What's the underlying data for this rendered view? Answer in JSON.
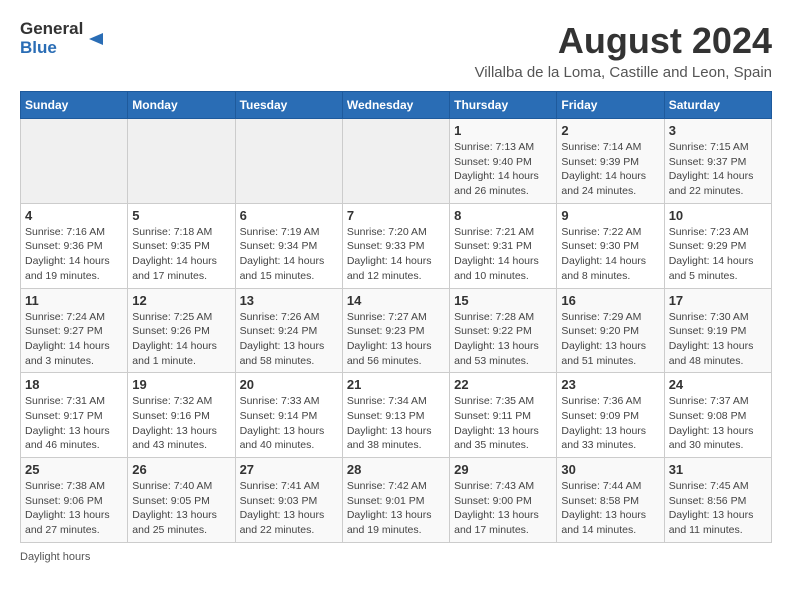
{
  "header": {
    "logo_general": "General",
    "logo_blue": "Blue",
    "title": "August 2024",
    "subtitle": "Villalba de la Loma, Castille and Leon, Spain"
  },
  "calendar": {
    "days_of_week": [
      "Sunday",
      "Monday",
      "Tuesday",
      "Wednesday",
      "Thursday",
      "Friday",
      "Saturday"
    ],
    "weeks": [
      [
        {
          "day": "",
          "info": ""
        },
        {
          "day": "",
          "info": ""
        },
        {
          "day": "",
          "info": ""
        },
        {
          "day": "",
          "info": ""
        },
        {
          "day": "1",
          "info": "Sunrise: 7:13 AM\nSunset: 9:40 PM\nDaylight: 14 hours and 26 minutes."
        },
        {
          "day": "2",
          "info": "Sunrise: 7:14 AM\nSunset: 9:39 PM\nDaylight: 14 hours and 24 minutes."
        },
        {
          "day": "3",
          "info": "Sunrise: 7:15 AM\nSunset: 9:37 PM\nDaylight: 14 hours and 22 minutes."
        }
      ],
      [
        {
          "day": "4",
          "info": "Sunrise: 7:16 AM\nSunset: 9:36 PM\nDaylight: 14 hours and 19 minutes."
        },
        {
          "day": "5",
          "info": "Sunrise: 7:18 AM\nSunset: 9:35 PM\nDaylight: 14 hours and 17 minutes."
        },
        {
          "day": "6",
          "info": "Sunrise: 7:19 AM\nSunset: 9:34 PM\nDaylight: 14 hours and 15 minutes."
        },
        {
          "day": "7",
          "info": "Sunrise: 7:20 AM\nSunset: 9:33 PM\nDaylight: 14 hours and 12 minutes."
        },
        {
          "day": "8",
          "info": "Sunrise: 7:21 AM\nSunset: 9:31 PM\nDaylight: 14 hours and 10 minutes."
        },
        {
          "day": "9",
          "info": "Sunrise: 7:22 AM\nSunset: 9:30 PM\nDaylight: 14 hours and 8 minutes."
        },
        {
          "day": "10",
          "info": "Sunrise: 7:23 AM\nSunset: 9:29 PM\nDaylight: 14 hours and 5 minutes."
        }
      ],
      [
        {
          "day": "11",
          "info": "Sunrise: 7:24 AM\nSunset: 9:27 PM\nDaylight: 14 hours and 3 minutes."
        },
        {
          "day": "12",
          "info": "Sunrise: 7:25 AM\nSunset: 9:26 PM\nDaylight: 14 hours and 1 minute."
        },
        {
          "day": "13",
          "info": "Sunrise: 7:26 AM\nSunset: 9:24 PM\nDaylight: 13 hours and 58 minutes."
        },
        {
          "day": "14",
          "info": "Sunrise: 7:27 AM\nSunset: 9:23 PM\nDaylight: 13 hours and 56 minutes."
        },
        {
          "day": "15",
          "info": "Sunrise: 7:28 AM\nSunset: 9:22 PM\nDaylight: 13 hours and 53 minutes."
        },
        {
          "day": "16",
          "info": "Sunrise: 7:29 AM\nSunset: 9:20 PM\nDaylight: 13 hours and 51 minutes."
        },
        {
          "day": "17",
          "info": "Sunrise: 7:30 AM\nSunset: 9:19 PM\nDaylight: 13 hours and 48 minutes."
        }
      ],
      [
        {
          "day": "18",
          "info": "Sunrise: 7:31 AM\nSunset: 9:17 PM\nDaylight: 13 hours and 46 minutes."
        },
        {
          "day": "19",
          "info": "Sunrise: 7:32 AM\nSunset: 9:16 PM\nDaylight: 13 hours and 43 minutes."
        },
        {
          "day": "20",
          "info": "Sunrise: 7:33 AM\nSunset: 9:14 PM\nDaylight: 13 hours and 40 minutes."
        },
        {
          "day": "21",
          "info": "Sunrise: 7:34 AM\nSunset: 9:13 PM\nDaylight: 13 hours and 38 minutes."
        },
        {
          "day": "22",
          "info": "Sunrise: 7:35 AM\nSunset: 9:11 PM\nDaylight: 13 hours and 35 minutes."
        },
        {
          "day": "23",
          "info": "Sunrise: 7:36 AM\nSunset: 9:09 PM\nDaylight: 13 hours and 33 minutes."
        },
        {
          "day": "24",
          "info": "Sunrise: 7:37 AM\nSunset: 9:08 PM\nDaylight: 13 hours and 30 minutes."
        }
      ],
      [
        {
          "day": "25",
          "info": "Sunrise: 7:38 AM\nSunset: 9:06 PM\nDaylight: 13 hours and 27 minutes."
        },
        {
          "day": "26",
          "info": "Sunrise: 7:40 AM\nSunset: 9:05 PM\nDaylight: 13 hours and 25 minutes."
        },
        {
          "day": "27",
          "info": "Sunrise: 7:41 AM\nSunset: 9:03 PM\nDaylight: 13 hours and 22 minutes."
        },
        {
          "day": "28",
          "info": "Sunrise: 7:42 AM\nSunset: 9:01 PM\nDaylight: 13 hours and 19 minutes."
        },
        {
          "day": "29",
          "info": "Sunrise: 7:43 AM\nSunset: 9:00 PM\nDaylight: 13 hours and 17 minutes."
        },
        {
          "day": "30",
          "info": "Sunrise: 7:44 AM\nSunset: 8:58 PM\nDaylight: 13 hours and 14 minutes."
        },
        {
          "day": "31",
          "info": "Sunrise: 7:45 AM\nSunset: 8:56 PM\nDaylight: 13 hours and 11 minutes."
        }
      ]
    ]
  },
  "footer": {
    "note": "Daylight hours"
  }
}
